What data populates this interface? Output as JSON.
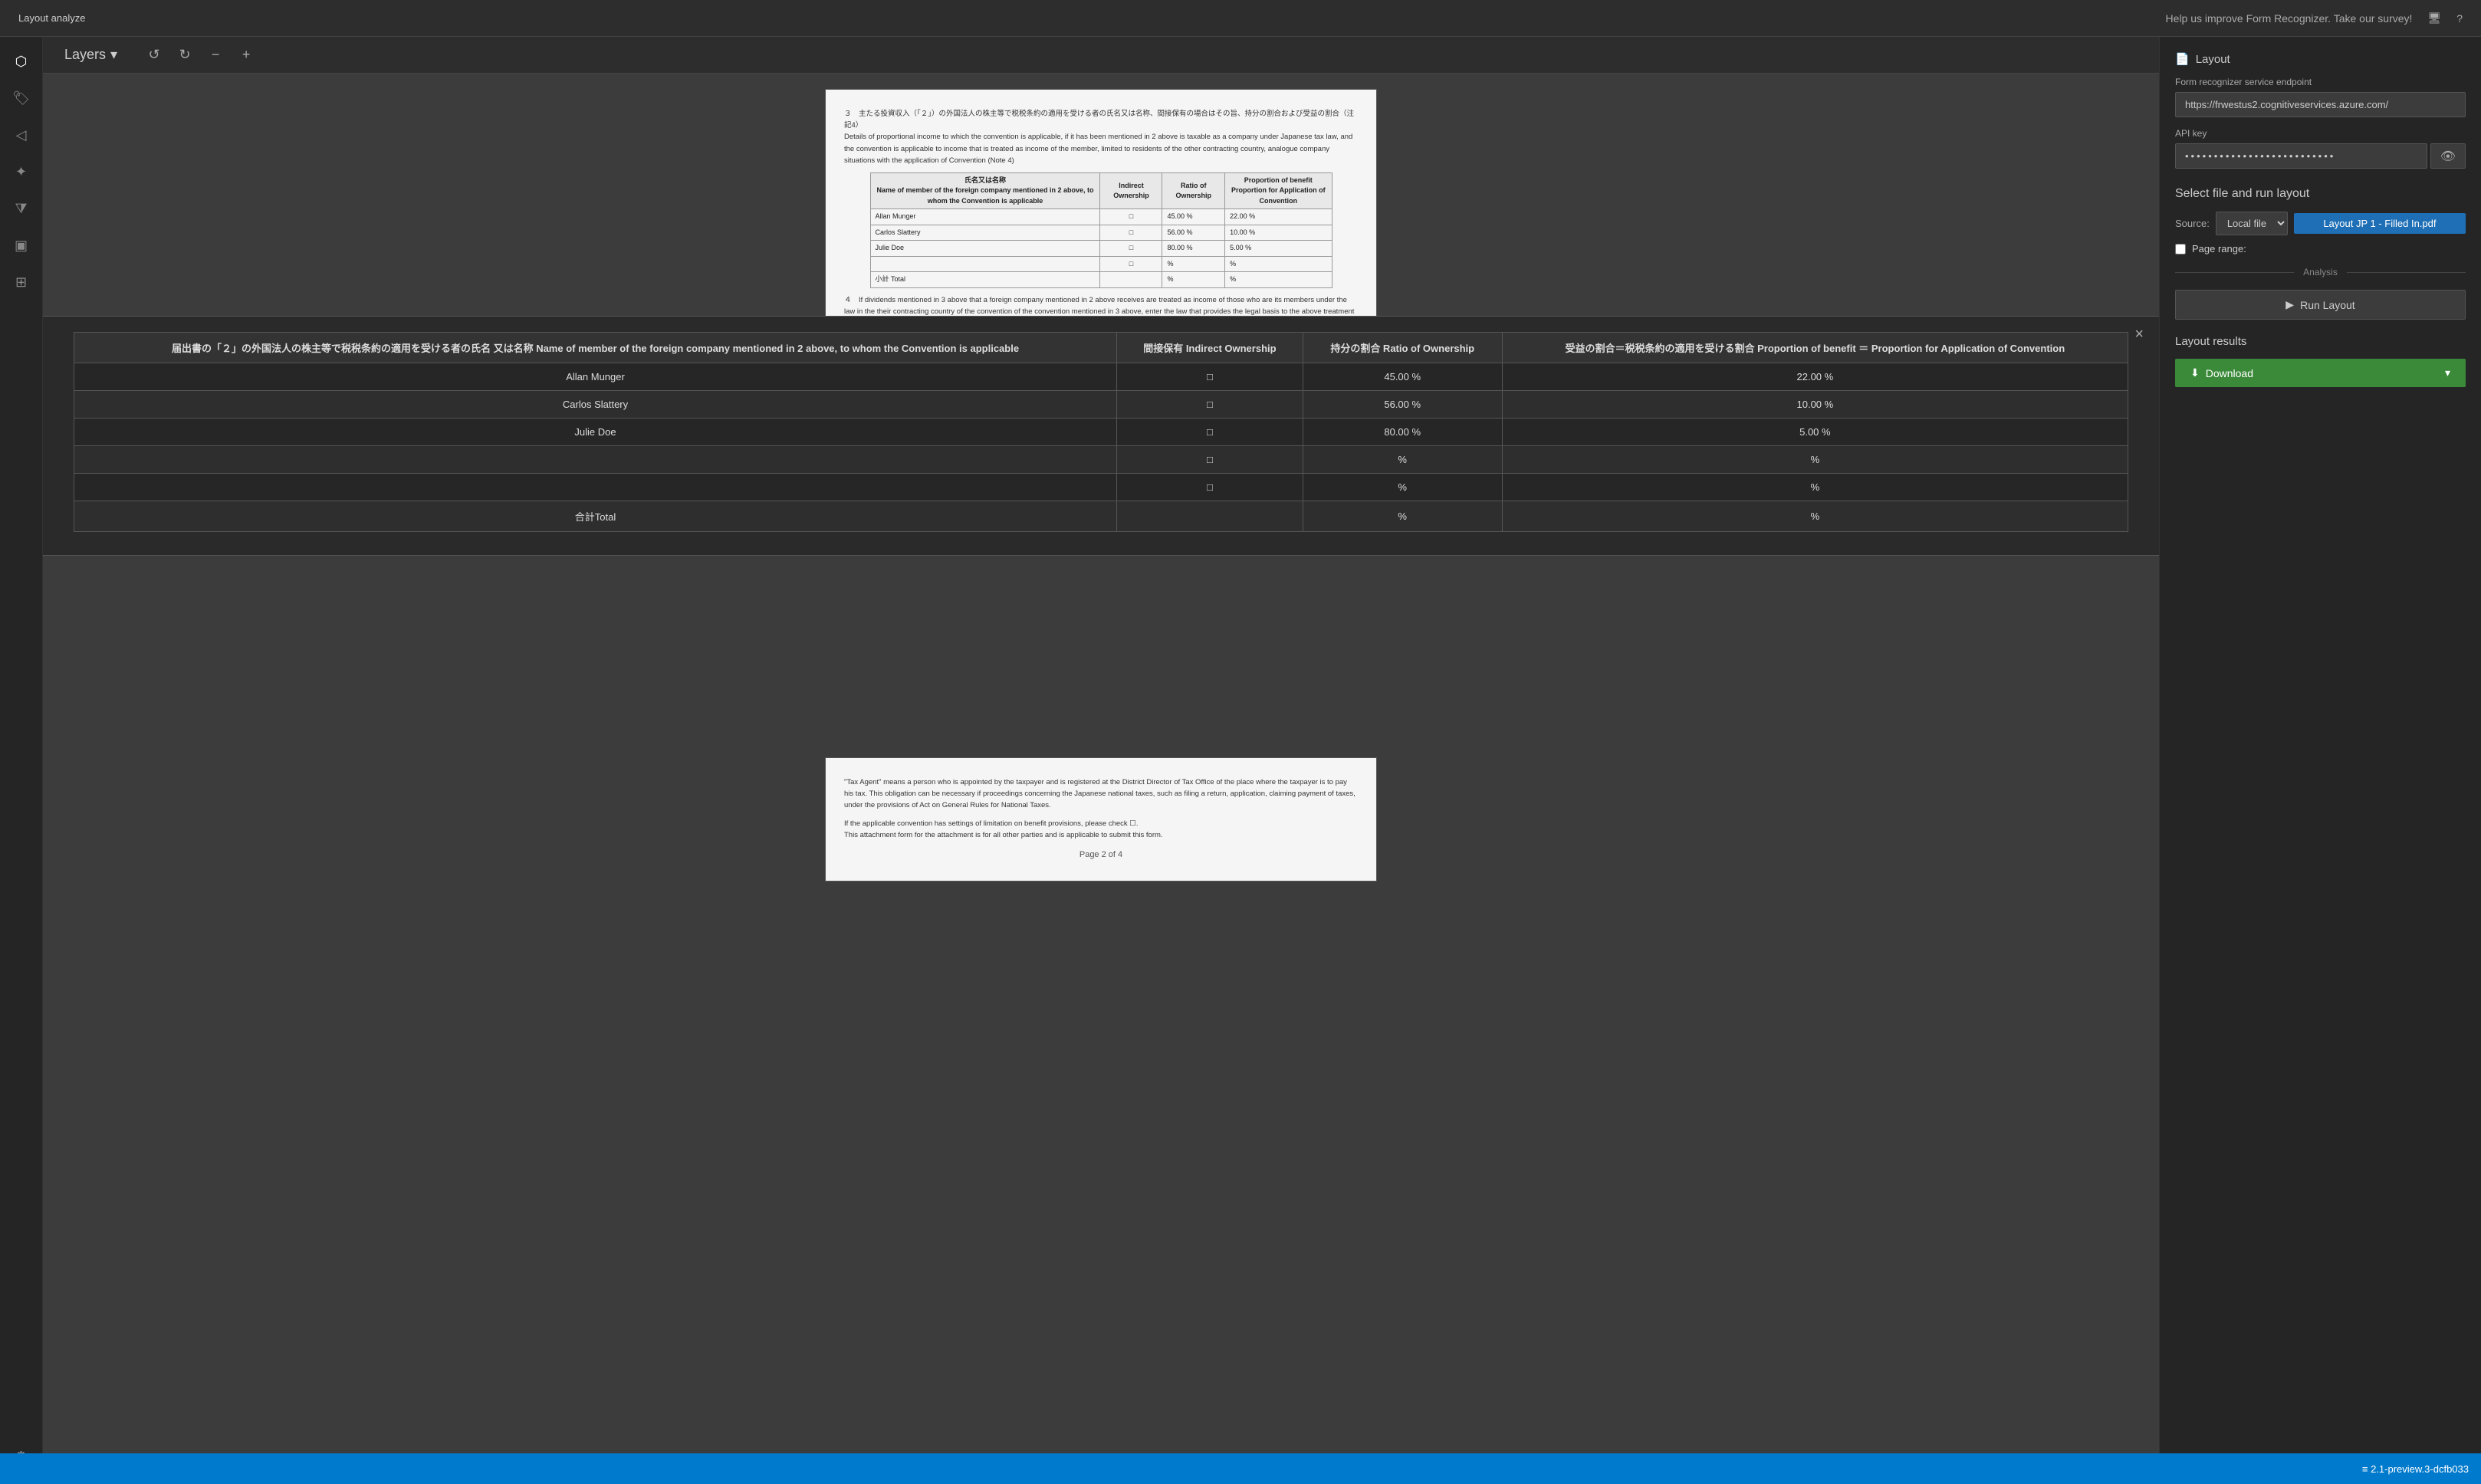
{
  "app": {
    "title": "Layout analyze",
    "version": "2.1-preview.3-dcfb033",
    "help_text": "Help us improve Form Recognizer. Take our survey!"
  },
  "toolbar": {
    "layers_label": "Layers",
    "undo_icon": "↺",
    "redo_icon": "↻",
    "zoom_out_icon": "−",
    "zoom_in_icon": "+"
  },
  "sidebar": {
    "icons": [
      "⬡",
      "☰",
      "◁",
      "✦",
      "⚙",
      "⬡",
      "▣",
      "⚙"
    ]
  },
  "right_panel": {
    "layout_title": "Layout",
    "endpoint_label": "Form recognizer service endpoint",
    "endpoint_value": "https://frwestus2.cognitiveservices.azure.com/",
    "api_key_label": "API key",
    "api_key_value": "••••••••••••••••••••••••••",
    "select_file_title": "Select file and run layout",
    "source_label": "Source:",
    "source_option": "Local file",
    "file_name": "Layout JP 1 - Filled In.pdf",
    "page_range_label": "Page range:",
    "analysis_label": "Analysis",
    "run_layout_label": "Run Layout",
    "results_title": "Layout results",
    "download_label": "Download"
  },
  "table_popup": {
    "close_icon": "×",
    "headers": [
      "届出書の「２」の外国法人の株主等で税税条約の適用を受ける者の氏名 又は名称 Name of member of the foreign company mentioned in 2 above, to whom the Convention is applicable",
      "間接保有 Indirect Ownership",
      "持分の割合 Ratio of Ownership",
      "受益の割合＝税税条約の適用を受ける割合 Proportion of benefit ＝ Proportion for Application of Convention"
    ],
    "rows": [
      {
        "name": "Allan Munger",
        "checkbox": "□",
        "ratio": "45.00 %",
        "proportion": "22.00 %"
      },
      {
        "name": "Carlos Slattery",
        "checkbox": "□",
        "ratio": "56.00 %",
        "proportion": "10.00 %"
      },
      {
        "name": "Julie Doe",
        "checkbox": "□",
        "ratio": "80.00 %",
        "proportion": "5.00 %"
      },
      {
        "name": "",
        "checkbox": "□",
        "ratio": "%",
        "proportion": "%"
      },
      {
        "name": "",
        "checkbox": "□",
        "ratio": "%",
        "proportion": "%"
      },
      {
        "name": "合計Total",
        "checkbox": "",
        "ratio": "%",
        "proportion": "%"
      }
    ]
  },
  "doc": {
    "page2_label": "Page 2 of 4"
  },
  "bottombar": {
    "version": "≡ 2.1-preview.3-dcfb033"
  }
}
